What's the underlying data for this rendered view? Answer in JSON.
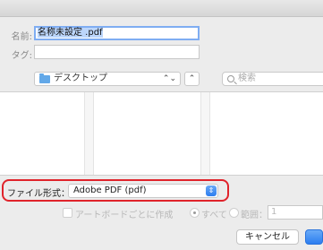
{
  "save_dialog": {
    "name_label": "名前:",
    "name_value": "名称未設定 .pdf",
    "tags_label": "タグ:",
    "tags_value": ""
  },
  "location": {
    "folder_name": "デスクトップ",
    "folder_icon": "folder-icon",
    "updown_glyph": "⌃⌄",
    "expand_glyph": "⌃",
    "search_placeholder": "検索"
  },
  "format": {
    "label": "ファイル形式：",
    "selected": "Adobe PDF (pdf)",
    "arrow_glyph": "⇕"
  },
  "options": {
    "artboard_checkbox_label": "アートボードごとに作成",
    "artboard_checked": false,
    "all_label": "すべて",
    "range_label": "範囲：",
    "range_value": "1",
    "selected_radio": "すべて"
  },
  "buttons": {
    "cancel": "キャンセル",
    "save": ""
  },
  "colors": {
    "highlight_frame": "#e0232b",
    "accent": "#2e7ef0",
    "selection": "#bcd6fb"
  }
}
